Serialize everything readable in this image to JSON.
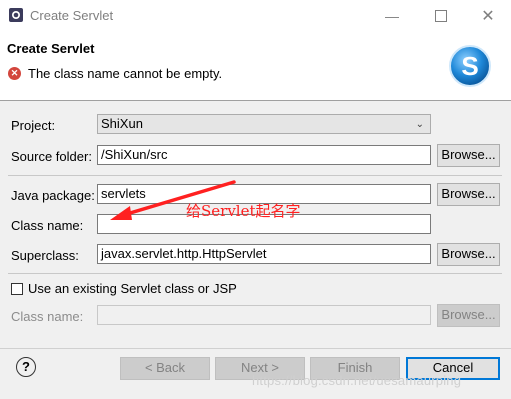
{
  "window": {
    "title": "Create Servlet",
    "controls": [
      "minimize-icon",
      "maximize-icon",
      "close-icon"
    ]
  },
  "header": {
    "title": "Create Servlet",
    "error_message": "The class name cannot be empty.",
    "error_icon": "error-icon",
    "logo_icon": "servlet-wizard-icon"
  },
  "form": {
    "project_label": "Project:",
    "project_value": "ShiXun",
    "source_folder_label": "Source folder:",
    "source_folder_value": "/ShiXun/src",
    "java_package_label": "Java package:",
    "java_package_value": "servlets",
    "class_name_label": "Class name:",
    "class_name_value": "",
    "superclass_label": "Superclass:",
    "superclass_value": "javax.servlet.http.HttpServlet",
    "browse_label": "Browse...",
    "use_existing_label": "Use an existing Servlet class or JSP",
    "use_existing_checked": false,
    "existing_class_label": "Class name:",
    "existing_class_value": ""
  },
  "buttons": {
    "back": "< Back",
    "next": "Next >",
    "finish": "Finish",
    "cancel": "Cancel"
  },
  "annotation": {
    "text": "给Servlet起名字",
    "color": "#ff2020"
  },
  "watermark": "https://blog.csdn.net/uesamaurping",
  "colors": {
    "error": "#d3463d",
    "logo_blue": "#1e88d8",
    "form_bg": "#f0f0f0"
  }
}
